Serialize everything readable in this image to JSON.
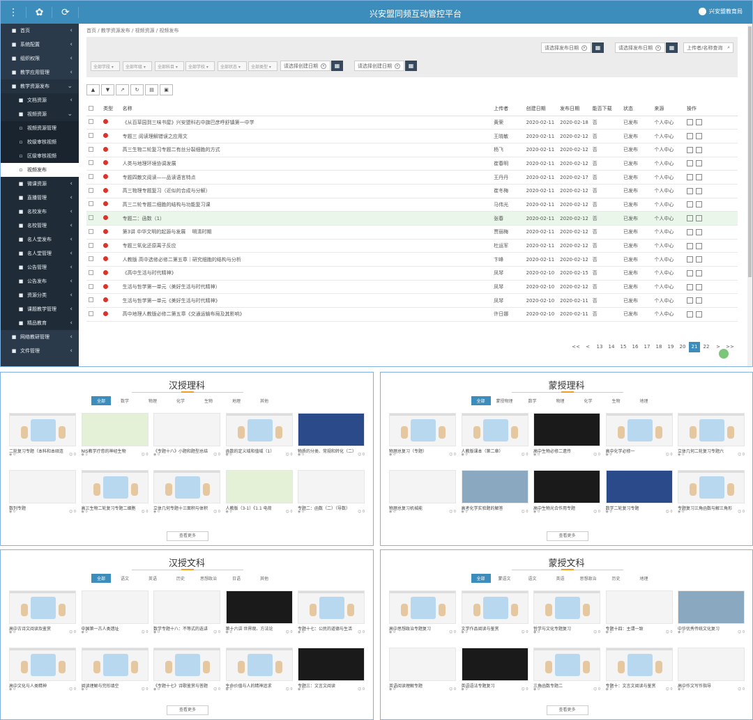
{
  "app_title": "兴安盟同频互动管控平台",
  "user": "兴安盟教育局",
  "sidebar": [
    {
      "label": "首页",
      "icon": "home-icon"
    },
    {
      "label": "系统配置",
      "icon": "gear-icon"
    },
    {
      "label": "组织权限",
      "icon": "lock-icon"
    },
    {
      "label": "教学应用管理",
      "icon": "book-icon"
    },
    {
      "label": "教学资源发布",
      "icon": "user-icon",
      "open": true
    },
    {
      "label": "文档资源",
      "sub": true
    },
    {
      "label": "视频资源",
      "sub": true,
      "open": true
    },
    {
      "label": "视频资源管理",
      "sub2": true
    },
    {
      "label": "校级审核视频",
      "sub2": true
    },
    {
      "label": "区级审核视频",
      "sub2": true
    },
    {
      "label": "视频发布",
      "sub2": true,
      "active": true
    },
    {
      "label": "微课资源",
      "sub": true
    },
    {
      "label": "直播管理",
      "sub": true
    },
    {
      "label": "名校发布",
      "sub": true
    },
    {
      "label": "名校管理",
      "sub": true
    },
    {
      "label": "名人堂发布",
      "sub": true
    },
    {
      "label": "名人堂管理",
      "sub": true
    },
    {
      "label": "公告管理",
      "sub": true
    },
    {
      "label": "公告发布",
      "sub": true
    },
    {
      "label": "资源分类",
      "sub": true
    },
    {
      "label": "课题教学管理",
      "sub": true
    },
    {
      "label": "精品教育",
      "sub": true
    },
    {
      "label": "网络教研管理",
      "icon": "chat-icon"
    },
    {
      "label": "文件管理",
      "icon": "folder-icon"
    }
  ],
  "breadcrumb": "首页 / 教学资源发布 / 视频资源 / 视频发布",
  "filter": {
    "publish_start": "请选择发布日期",
    "publish_end": "请选择发布日期",
    "search_placeholder": "上传者/名称查询",
    "selects": [
      "全部学段",
      "全部年级",
      "全部科目",
      "全部学校",
      "全部状态",
      "全部类型",
      "全部批注"
    ],
    "create_start": "请选择创建日期",
    "create_end": "请选择创建日期"
  },
  "table": {
    "headers": [
      "类型",
      "名称",
      "上传者",
      "创建日期",
      "发布日期",
      "能否下载",
      "状态",
      "来源",
      "操作"
    ],
    "rows": [
      [
        "《从百草园到三味书屋》兴安盟科右中旗巴彦呼舒镇第一中学",
        "黄荣",
        "2020-02-11",
        "2020-02-18",
        "否",
        "已发布",
        "个人中心"
      ],
      [
        "专题三 阅读理解错误之应用文",
        "王晓敏",
        "2020-02-11",
        "2020-02-12",
        "否",
        "已发布",
        "个人中心"
      ],
      [
        "高三生物二轮复习专题二有丝分裂细胞的方式",
        "杨飞",
        "2020-02-11",
        "2020-02-12",
        "否",
        "已发布",
        "个人中心"
      ],
      [
        "人类与地理环境协调发展",
        "崔春明",
        "2020-02-11",
        "2020-02-12",
        "否",
        "已发布",
        "个人中心"
      ],
      [
        "专题四散文阅读——品读语言特点",
        "王丹丹",
        "2020-02-11",
        "2020-02-17",
        "否",
        "已发布",
        "个人中心"
      ],
      [
        "高三物理专题复习（近似的合成与分解）",
        "崔冬梅",
        "2020-02-11",
        "2020-02-12",
        "否",
        "已发布",
        "个人中心"
      ],
      [
        "高三二轮专题二细胞的结构与功能复习课",
        "马伟光",
        "2020-02-11",
        "2020-02-12",
        "否",
        "已发布",
        "个人中心"
      ],
      [
        "专题二：函数（1）",
        "张春",
        "2020-02-11",
        "2020-02-12",
        "否",
        "已发布",
        "个人中心"
      ],
      [
        "第3讲 中华文明的起源与发展 　明清时期",
        "贾丽梅",
        "2020-02-11",
        "2020-02-12",
        "否",
        "已发布",
        "个人中心"
      ],
      [
        "专题三氧化还原离子反应",
        "杜运军",
        "2020-02-11",
        "2020-02-12",
        "否",
        "已发布",
        "个人中心"
      ],
      [
        "人教版 高中选修必修二第五章｜研究细胞的结构与分析",
        "卞峰",
        "2020-02-11",
        "2020-02-12",
        "否",
        "已发布",
        "个人中心"
      ],
      [
        "《高中生活与时代精神》",
        "凤琴",
        "2020-02-10",
        "2020-02-15",
        "否",
        "已发布",
        "个人中心"
      ],
      [
        "生活与哲学第一单元（美好生活与时代精神）",
        "凤琴",
        "2020-02-10",
        "2020-02-12",
        "否",
        "已发布",
        "个人中心"
      ],
      [
        "生活与哲学第一单元《美好生活与时代精神》",
        "凤琴",
        "2020-02-10",
        "2020-02-11",
        "否",
        "已发布",
        "个人中心"
      ],
      [
        "高中地理人教版必修二第五章《交通运输布局及其影响》",
        "许日娜",
        "2020-02-10",
        "2020-02-11",
        "否",
        "已发布",
        "个人中心"
      ]
    ]
  },
  "pager": [
    "<<",
    "<",
    "13",
    "14",
    "15",
    "16",
    "17",
    "18",
    "19",
    "20",
    "21",
    "22",
    ">",
    ">>"
  ],
  "pager_active": "21",
  "panels": [
    {
      "title": "汉授理科",
      "tabs": [
        "全部",
        "数学",
        "物理",
        "化学",
        "生物",
        "地理",
        "其他"
      ],
      "more": "查看更多",
      "cards": [
        {
          "title": "二轮复习专题（本科和本硕连",
          "views": "0",
          "likes": "0",
          "kind": "fig"
        },
        {
          "title": "NIS教学疗愈的神经生物",
          "views": "0",
          "likes": "0",
          "kind": "green"
        },
        {
          "title": "《专题十八》小题和题型总结",
          "views": "0",
          "likes": "0",
          "kind": "plain"
        },
        {
          "title": "函数的定义域和值域（1）",
          "views": "0",
          "likes": "0",
          "kind": "fig"
        },
        {
          "title": "物质的分类、常规和转化（二）",
          "views": "0",
          "likes": "0",
          "kind": "blue"
        },
        {
          "title": "数列专题",
          "views": "0",
          "likes": "0",
          "kind": "plain"
        },
        {
          "title": "高三生物二轮复习专题二细胞",
          "views": "0",
          "likes": "0",
          "kind": "fig"
        },
        {
          "title": "立体几何专题十三面积与体积",
          "views": "0",
          "likes": "0",
          "kind": "fig"
        },
        {
          "title": "人教版（3-1）《1.1 电荷",
          "views": "0",
          "likes": "0",
          "kind": "green"
        },
        {
          "title": "专题二：函数（二）（导数）",
          "views": "0",
          "likes": "0",
          "kind": "plain"
        }
      ]
    },
    {
      "title": "蒙授理科",
      "tabs": [
        "全部",
        "蒙授物理",
        "数学",
        "物理",
        "化学",
        "生物",
        "地理"
      ],
      "more": "查看更多",
      "cards": [
        {
          "title": "物理总复习（专题）",
          "views": "0",
          "likes": "0",
          "kind": "fig"
        },
        {
          "title": "人教版课本（第二章）",
          "views": "0",
          "likes": "0",
          "kind": "fig"
        },
        {
          "title": "高中生物必修二遗传",
          "views": "0",
          "likes": "0",
          "kind": "dark"
        },
        {
          "title": "高中化学必修一",
          "views": "0",
          "likes": "0",
          "kind": "fig"
        },
        {
          "title": "立体几何二轮复习专题六",
          "views": "0",
          "likes": "0",
          "kind": "fig"
        },
        {
          "title": "物理总复习机械能",
          "views": "0",
          "likes": "0",
          "kind": "plain"
        },
        {
          "title": "高考化学实验题的解答",
          "views": "0",
          "likes": "0",
          "kind": "photo"
        },
        {
          "title": "高中生物光合作用专题",
          "views": "0",
          "likes": "0",
          "kind": "dark"
        },
        {
          "title": "数学二轮复习专题",
          "views": "0",
          "likes": "0",
          "kind": "blue"
        },
        {
          "title": "专题复习三角函数与解三角形",
          "views": "0",
          "likes": "0",
          "kind": "fig"
        }
      ]
    },
    {
      "title": "汉授文科",
      "tabs": [
        "全部",
        "语文",
        "英语",
        "历史",
        "思想政治",
        "日语",
        "其他"
      ],
      "more": "查看更多",
      "cards": [
        {
          "title": "高中古诗文阅读及鉴赏",
          "views": "0",
          "likes": "0",
          "kind": "fig"
        },
        {
          "title": "中国第一古人类遗址",
          "views": "0",
          "likes": "0",
          "kind": "plain"
        },
        {
          "title": "数学专题十八：不等式的选讲",
          "views": "0",
          "likes": "0",
          "kind": "plain"
        },
        {
          "title": "第十六讲 世界观、方法论",
          "views": "0",
          "likes": "0",
          "kind": "dark"
        },
        {
          "title": "专题十七：公民的道德与生活",
          "views": "0",
          "likes": "0",
          "kind": "fig"
        },
        {
          "title": "高中文化与人类精神",
          "views": "0",
          "likes": "0",
          "kind": "fig"
        },
        {
          "title": "阅读理解与完形填空",
          "views": "0",
          "likes": "0",
          "kind": "fig"
        },
        {
          "title": "《专题十七》诗歌鉴赏与答题",
          "views": "0",
          "likes": "0",
          "kind": "fig"
        },
        {
          "title": "生命价值与人的精神追求",
          "views": "0",
          "likes": "0",
          "kind": "fig"
        },
        {
          "title": "专题三：文言文阅读",
          "views": "0",
          "likes": "0",
          "kind": "dark"
        }
      ]
    },
    {
      "title": "蒙授文科",
      "tabs": [
        "全部",
        "蒙语文",
        "语文",
        "英语",
        "思想政治",
        "历史",
        "地理"
      ],
      "more": "查看更多",
      "cards": [
        {
          "title": "高中思想政治专题复习",
          "views": "0",
          "likes": "0",
          "kind": "fig"
        },
        {
          "title": "文学作品阅读与鉴赏",
          "views": "0",
          "likes": "0",
          "kind": "fig"
        },
        {
          "title": "哲学与文化专题复习",
          "views": "0",
          "likes": "0",
          "kind": "fig"
        },
        {
          "title": "专题十四：主谓一致",
          "views": "0",
          "likes": "0",
          "kind": "plain"
        },
        {
          "title": "中华优秀传统文化复习",
          "views": "0",
          "likes": "0",
          "kind": "photo"
        },
        {
          "title": "英语阅读理解专题",
          "views": "0",
          "likes": "0",
          "kind": "plain"
        },
        {
          "title": "英语语法专题复习",
          "views": "0",
          "likes": "0",
          "kind": "dark"
        },
        {
          "title": "三角函数专题二",
          "views": "0",
          "likes": "0",
          "kind": "fig"
        },
        {
          "title": "专题十：文言文阅读与鉴赏",
          "views": "0",
          "likes": "0",
          "kind": "fig"
        },
        {
          "title": "高中作文写作指导",
          "views": "0",
          "likes": "0",
          "kind": "plain"
        }
      ]
    }
  ]
}
